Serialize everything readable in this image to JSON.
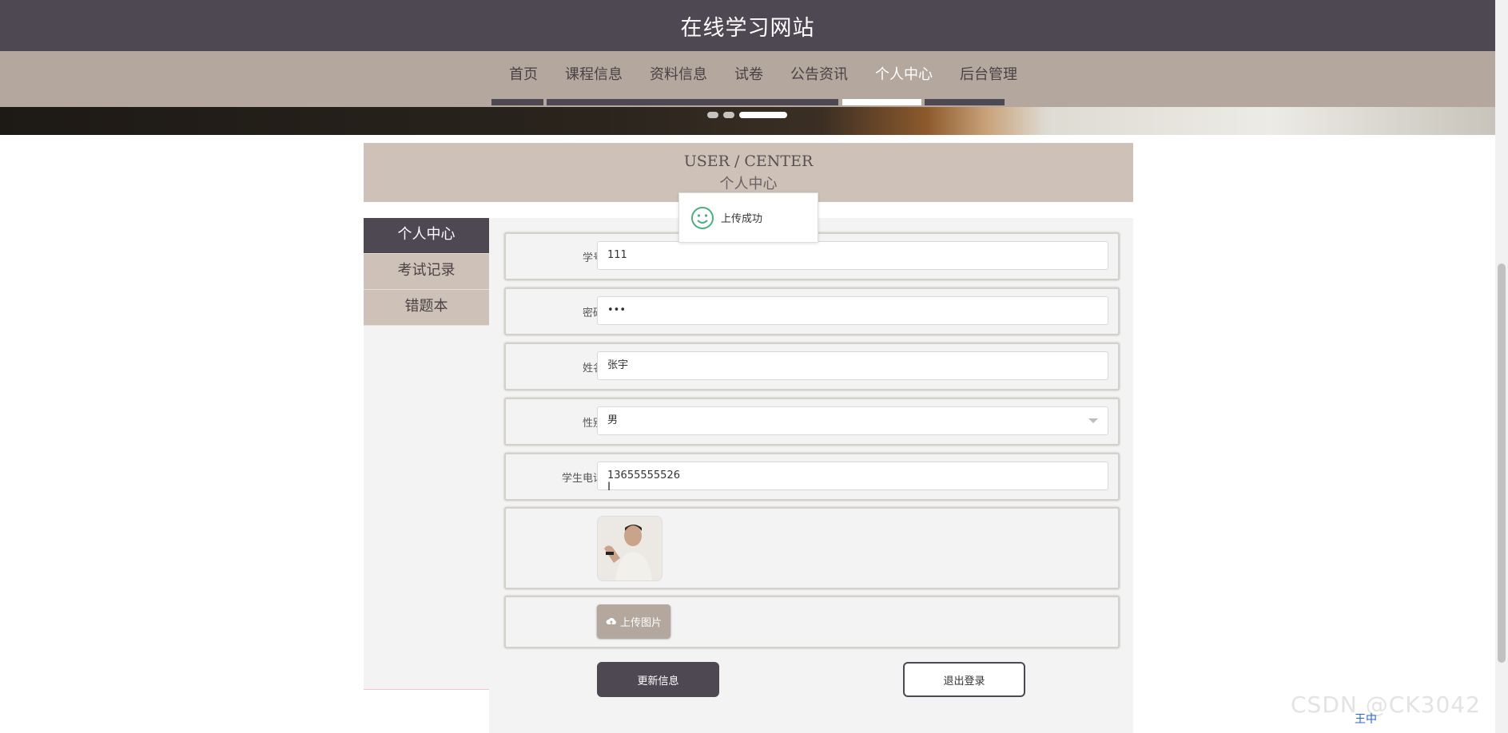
{
  "site": {
    "title": "在线学习网站"
  },
  "nav": {
    "items": [
      {
        "label": "首页"
      },
      {
        "label": "课程信息"
      },
      {
        "label": "资料信息"
      },
      {
        "label": "试卷"
      },
      {
        "label": "公告资讯"
      },
      {
        "label": "个人中心",
        "active": true
      },
      {
        "label": "后台管理"
      }
    ]
  },
  "banner": {
    "slides": 3,
    "active_slide": 3
  },
  "center": {
    "en_title": "USER / CENTER",
    "cn_title": "个人中心"
  },
  "sidebar": {
    "items": [
      {
        "label": "个人中心",
        "active": true
      },
      {
        "label": "考试记录"
      },
      {
        "label": "错题本"
      }
    ]
  },
  "form": {
    "fields": [
      {
        "label": "学号",
        "value": "111"
      },
      {
        "label": "密码",
        "value": "•••"
      },
      {
        "label": "姓名",
        "value": "张宇"
      },
      {
        "label": "性别",
        "value": "男"
      },
      {
        "label": "学生电话",
        "value": "13655555526"
      }
    ],
    "upload_label": "上传图片",
    "update_button": "更新信息",
    "logout_button": "退出登录"
  },
  "toast": {
    "message": "上传成功"
  },
  "watermark": "CSDN @CK3042",
  "ime_text": "王中"
}
